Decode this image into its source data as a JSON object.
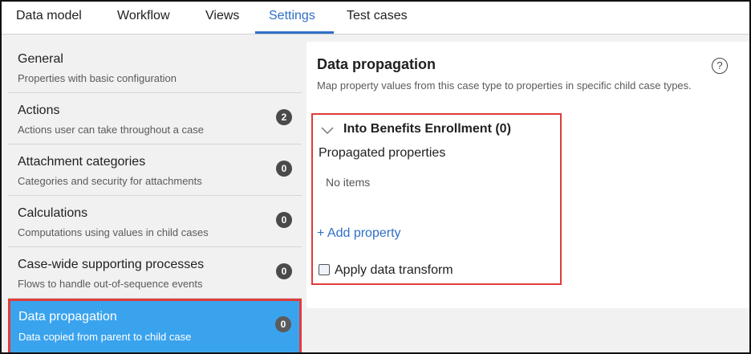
{
  "tabs": [
    {
      "label": "Data model"
    },
    {
      "label": "Workflow"
    },
    {
      "label": "Views"
    },
    {
      "label": "Settings",
      "active": true
    },
    {
      "label": "Test cases"
    }
  ],
  "sidebar": {
    "items": [
      {
        "title": "General",
        "desc": "Properties with basic configuration"
      },
      {
        "title": "Actions",
        "desc": "Actions user can take throughout a case",
        "count": "2"
      },
      {
        "title": "Attachment categories",
        "desc": "Categories and security for attachments",
        "count": "0"
      },
      {
        "title": "Calculations",
        "desc": "Computations using values in child cases",
        "count": "0"
      },
      {
        "title": "Case-wide supporting processes",
        "desc": "Flows to handle out-of-sequence events",
        "count": "0"
      },
      {
        "title": "Data propagation",
        "desc": "Data copied from parent to child case",
        "count": "0",
        "selected": true
      }
    ]
  },
  "main": {
    "title": "Data propagation",
    "help_icon": "?",
    "description": "Map property values from this case type to properties in specific child case types.",
    "section": {
      "title": "Into Benefits Enrollment (0)",
      "propagated_label": "Propagated properties",
      "empty_text": "No items",
      "add_link": "+ Add property",
      "apply_label": "Apply data transform",
      "apply_checked": false
    }
  },
  "colors": {
    "accent": "#2f6fc6",
    "selected_bg": "#3aa3ee",
    "highlight_border": "#e03b3b",
    "badge": "#4a4a4a"
  }
}
